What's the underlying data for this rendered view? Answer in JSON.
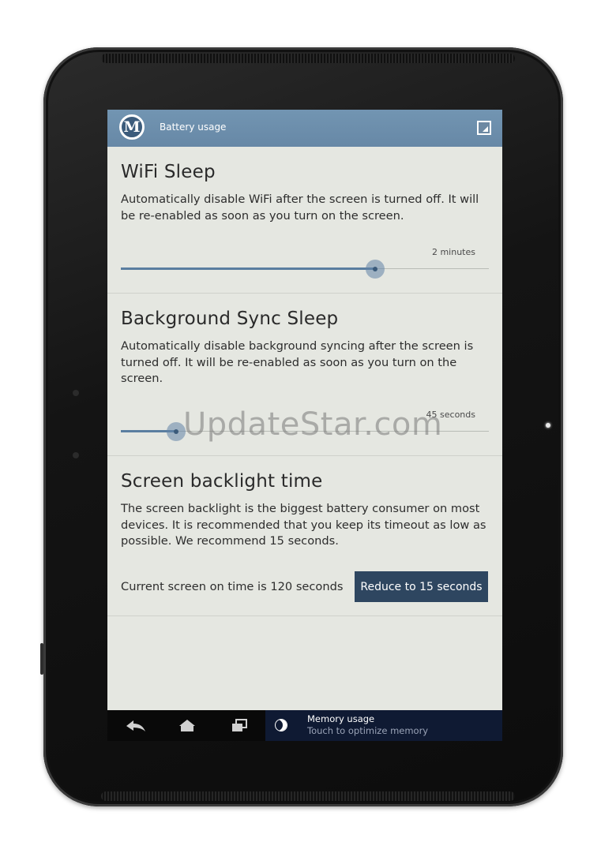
{
  "action_bar": {
    "logo_letter": "M",
    "title": "Battery usage",
    "overflow_icon": "resize-corner-icon"
  },
  "sections": {
    "wifi": {
      "title": "WiFi Sleep",
      "description": "Automatically disable WiFi after the screen is turned off. It will be re-enabled as soon as you turn on the screen.",
      "value_label": "2 minutes",
      "slider_position": 0.69
    },
    "sync": {
      "title": "Background Sync Sleep",
      "description": "Automatically disable background syncing after the screen is turned off. It will be re-enabled as soon as you turn on the screen.",
      "value_label": "45 seconds",
      "slider_position": 0.15
    },
    "backlight": {
      "title": "Screen backlight time",
      "description": "The screen backlight is the biggest battery consumer on most devices. It is recommended that you keep its timeout as low as possible. We recommend 15 seconds.",
      "current_text": "Current screen on time is 120 seconds",
      "button_label": "Reduce to 15 seconds"
    }
  },
  "watermark": "UpdateStar.com",
  "navbar": {
    "back_icon": "back-icon",
    "home_icon": "home-icon",
    "recents_icon": "recent-apps-icon",
    "notification_icon": "moon-icon",
    "notification_title": "Memory usage",
    "notification_subtitle": "Touch to optimize memory"
  },
  "colors": {
    "action_bar": "#6b8ca9",
    "screen_bg": "#e5e7e1",
    "button_bg": "#2e4660",
    "slider": "#5a7ea0"
  }
}
